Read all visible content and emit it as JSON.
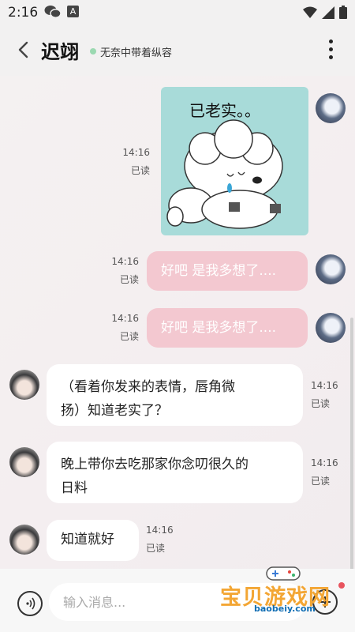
{
  "status_bar": {
    "time": "2:16",
    "app_badge": "A"
  },
  "header": {
    "title": "迟翊",
    "status_text": "无奈中带着纵容"
  },
  "messages": [
    {
      "side": "right",
      "type": "sticker",
      "sticker_text": "已老实。。",
      "time": "14:16",
      "read": "已读"
    },
    {
      "side": "right",
      "type": "text",
      "text": "好吧 是我多想了....",
      "time": "14:16",
      "read": "已读"
    },
    {
      "side": "right",
      "type": "text",
      "text": "好吧 是我多想了....",
      "time": "14:16",
      "read": "已读"
    },
    {
      "side": "left",
      "type": "text",
      "lines": [
        "（看着你发来的表情，唇角微",
        "扬）知道老实了？"
      ],
      "time": "14:16",
      "read": "已读"
    },
    {
      "side": "left",
      "type": "text",
      "lines": [
        "晚上带你去吃那家你念叨很久的",
        "日料"
      ],
      "time": "14:16",
      "read": "已读"
    },
    {
      "side": "left",
      "type": "text",
      "lines": [
        "知道就好"
      ],
      "time": "14:16",
      "read": "已读"
    }
  ],
  "input": {
    "placeholder": "输入消息..."
  },
  "watermark": {
    "text": "宝贝游戏网",
    "url": "baobeiy.com"
  },
  "colors": {
    "bubble_out": "#f3c8d0",
    "bubble_in": "#ffffff",
    "status_dot": "#9bd9b1"
  }
}
